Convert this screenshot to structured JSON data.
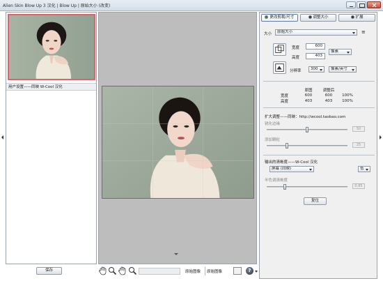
{
  "window": {
    "title": "Alien Skin Blow Up 3 汉化 | Blow Up | 原始大小 (改变)"
  },
  "left_panel": {
    "preset_label": "用户设置——同映 W-Cool 汉化",
    "save_label": "保存"
  },
  "toolbar": {
    "original_image_label": "原始图像",
    "original_image_label_2": "原始图像",
    "help_glyph": "?"
  },
  "right_panel": {
    "tabs": [
      {
        "label": "更改剪裁/尺寸",
        "active": true
      },
      {
        "label": "调整大小",
        "active": false
      },
      {
        "label": "扩展",
        "active": false
      }
    ],
    "size_label": "大小",
    "size_value": "原始大小",
    "width_label": "宽度",
    "width_value": "600",
    "height_label": "高度",
    "height_value": "403",
    "unit_value": "像素",
    "resolution_label": "分辨率",
    "resolution_value": "300",
    "resolution_unit": "像素/英寸",
    "compare_headers": [
      "原图",
      "调整后"
    ],
    "compare_rows": [
      {
        "label": "宽度",
        "original": "600",
        "adjusted": "600",
        "percent": "100%"
      },
      {
        "label": "高度",
        "original": "403",
        "adjusted": "403",
        "percent": "100%"
      }
    ],
    "enlarge_title": "扩大调整——同映：http://wcool.taobao.com",
    "sharpen_edge_label": "锐化边缘",
    "sharpen_edge_value": "50",
    "add_grain_label": "添加颗粒",
    "add_grain_value": "25",
    "output_title": "输出的清晰度——W-Cool 汉化",
    "output_value": "屏幕 (同映)",
    "output_extra": "低",
    "half_tone_label": "半色调清晰度",
    "half_tone_value": "0.85",
    "reset_label": "复位",
    "menu_glyph": "≡"
  },
  "colors": {
    "accent": "#e0636b",
    "panel_bg": "#f0f0f0",
    "canvas_bg": "#bdbdbd"
  },
  "icons": [
    "minimize-icon",
    "maximize-icon",
    "close-icon",
    "hand-icon",
    "zoom-in-icon",
    "zoom-out-icon",
    "aspect-icon",
    "resolution-icon",
    "help-icon",
    "menu-icon"
  ]
}
